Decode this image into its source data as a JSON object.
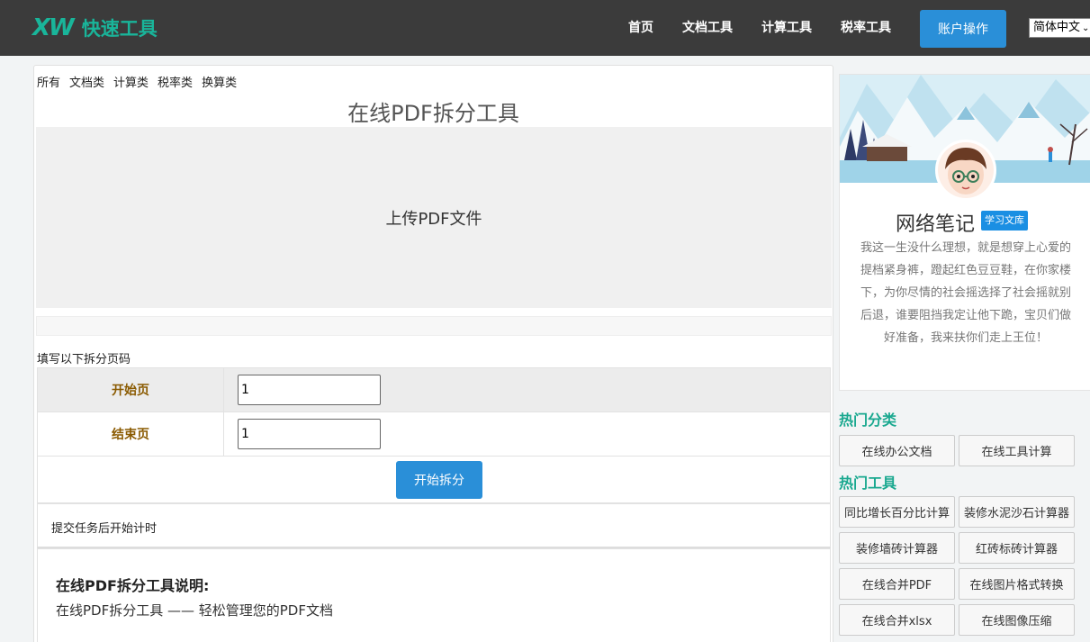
{
  "header": {
    "logo_mark": "XW",
    "logo_text": "快速工具",
    "nav": [
      "首页",
      "文档工具",
      "计算工具",
      "税率工具"
    ],
    "account_button": "账户操作",
    "language": "简体中文"
  },
  "main": {
    "categories": [
      "所有",
      "文档类",
      "计算类",
      "税率类",
      "换算类"
    ],
    "title": "在线PDF拆分工具",
    "upload_label": "上传PDF文件",
    "fill_label": "填写以下拆分页码",
    "start_label": "开始页",
    "start_value": "1",
    "end_label": "结束页",
    "end_value": "1",
    "split_button": "开始拆分",
    "timer_text": "提交任务后开始计时",
    "desc_title": "在线PDF拆分工具说明:",
    "desc_text": "在线PDF拆分工具 —— 轻松管理您的PDF文档"
  },
  "sidebar": {
    "profile_name": "网络笔记",
    "profile_badge": "学习文库",
    "profile_bio": "我这一生没什么理想，就是想穿上心爱的提档紧身裤，蹬起红色豆豆鞋，在你家楼下，为你尽情的社会摇选择了社会摇就别后退，谁要阻挡我定让他下跪，宝贝们做好准备，我来扶你们走上王位！",
    "hot_categories_title": "热门分类",
    "hot_categories": [
      "在线办公文档",
      "在线工具计算"
    ],
    "hot_tools_title": "热门工具",
    "hot_tools": [
      "同比增长百分比计算",
      "装修水泥沙石计算器",
      "装修墙砖计算器",
      "红砖标砖计算器",
      "在线合并PDF",
      "在线图片格式转换",
      "在线合并xlsx",
      "在线图像压缩"
    ]
  },
  "colors": {
    "header_bg": "#3b3b3b",
    "brand_teal": "#19b59a",
    "button_blue": "#2a8fd8",
    "label_brown": "#8a5a00"
  }
}
